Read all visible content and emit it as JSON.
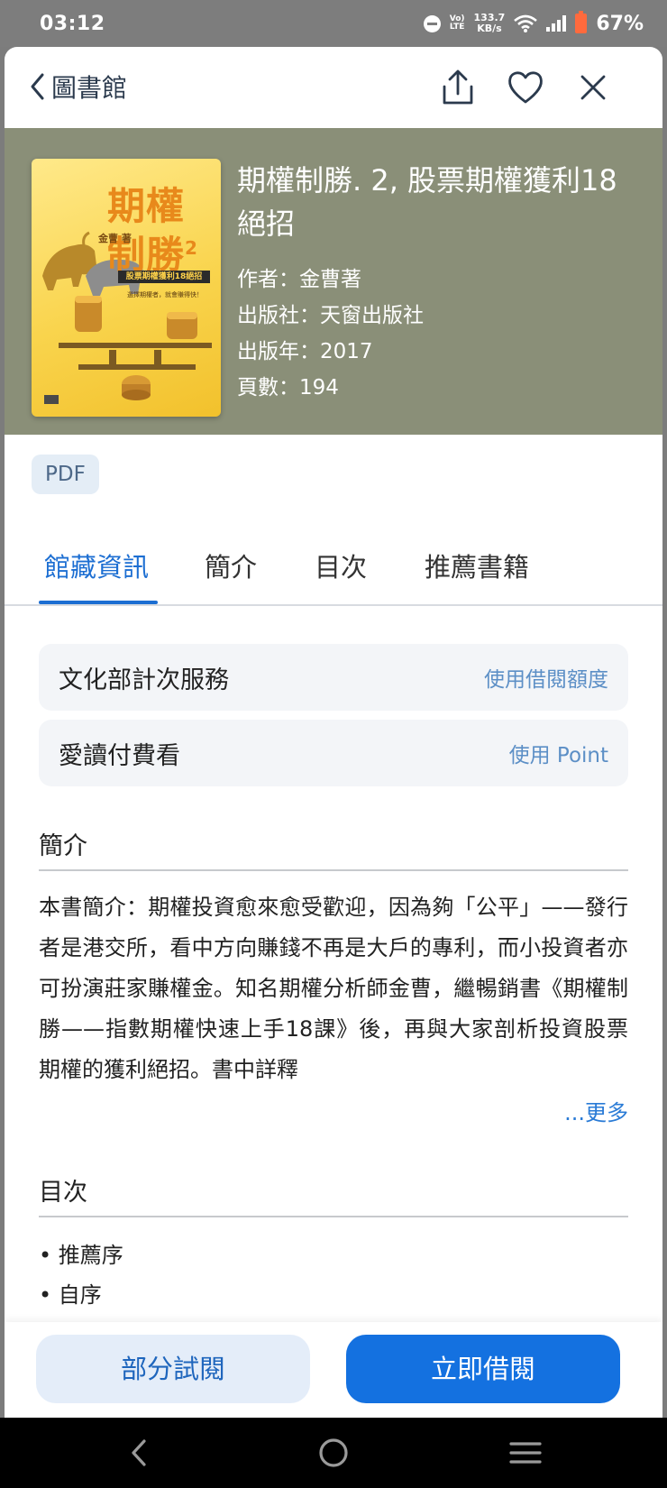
{
  "status_bar": {
    "time": "03:12",
    "network_small_top": "Vo)",
    "network_small_bottom": "LTE",
    "speed_top": "133.7",
    "speed_bottom": "KB/s",
    "battery": "67%"
  },
  "topbar": {
    "back_label": "圖書館",
    "icons": [
      "share-icon",
      "heart-icon",
      "close-icon"
    ]
  },
  "book": {
    "title": "期權制勝. 2, 股票期權獲利18絕招",
    "author": "作者：金曹著",
    "publisher": "出版社：天窗出版社",
    "year": "出版年：2017",
    "pages": "頁數：194",
    "cover": {
      "title_line1": "期權",
      "title_line2": "制勝",
      "title_sup": "2",
      "author": "金曹 著",
      "subtitle": "股票期權獲利18絕招",
      "blurb": "選擇期權者，就會賺得快！"
    }
  },
  "format_chip": "PDF",
  "tabs": [
    {
      "label": "館藏資訊",
      "active": true
    },
    {
      "label": "簡介",
      "active": false
    },
    {
      "label": "目次",
      "active": false
    },
    {
      "label": "推薦書籍",
      "active": false
    }
  ],
  "services": [
    {
      "name": "文化部計次服務",
      "action": "使用借閱額度"
    },
    {
      "name": "愛讀付費看",
      "action": "使用 Point"
    }
  ],
  "intro": {
    "heading": "簡介",
    "text": "本書簡介：期權投資愈來愈受歡迎，因為夠「公平」——發行者是港交所，看中方向賺錢不再是大戶的專利，而小投資者亦可扮演莊家賺權金。知名期權分析師金曹，繼暢銷書《期權制勝——指數期權快速上手18課》後，再與大家剖析投資股票期權的獲利絕招。書中詳釋",
    "more": "...更多"
  },
  "toc": {
    "heading": "目次",
    "items": [
      "• 推薦序",
      "• 自序"
    ]
  },
  "actions": {
    "preview": "部分試閱",
    "borrow": "立即借閱"
  },
  "nav_icons": [
    "nav-back-icon",
    "nav-home-icon",
    "nav-recents-icon"
  ],
  "colors": {
    "accent": "#1471e0",
    "hero_bg": "#8a8f78",
    "link": "#5c8fc6"
  }
}
